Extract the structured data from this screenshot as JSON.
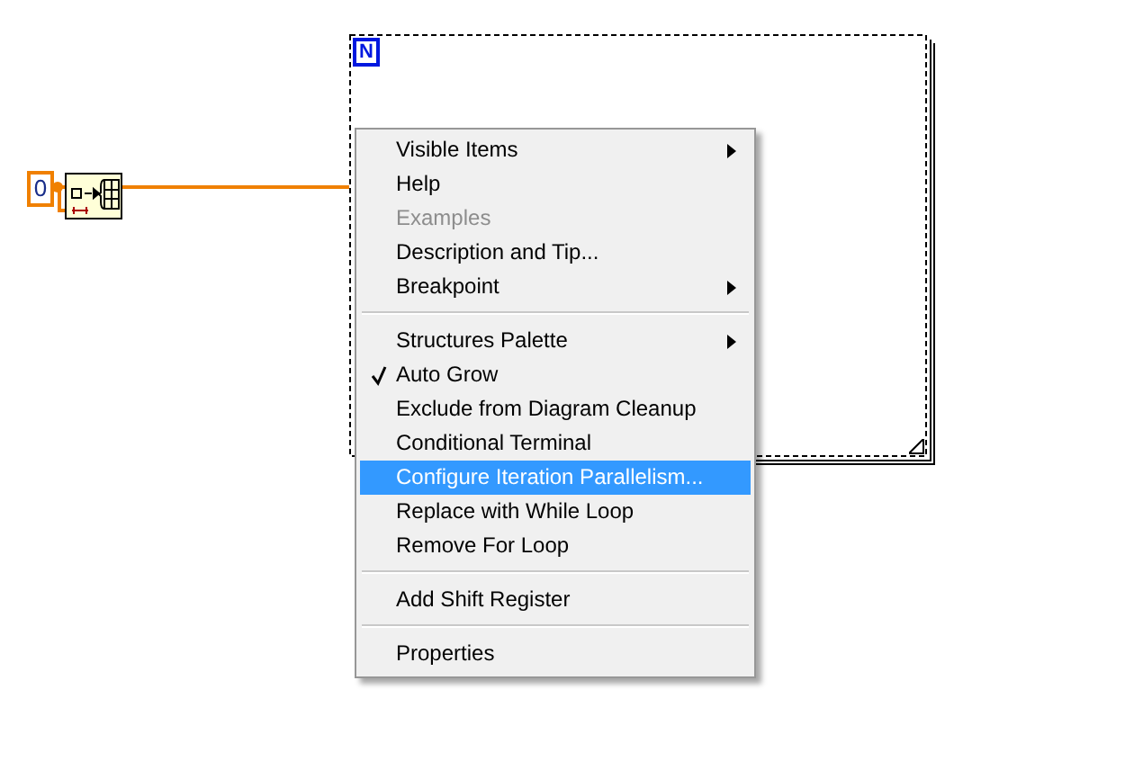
{
  "diagram": {
    "constant": "0",
    "loop_count_label": "N"
  },
  "context_menu": {
    "sections": [
      [
        {
          "label": "Visible Items",
          "submenu": true,
          "disabled": false,
          "checked": false,
          "selected": false
        },
        {
          "label": "Help",
          "submenu": false,
          "disabled": false,
          "checked": false,
          "selected": false
        },
        {
          "label": "Examples",
          "submenu": false,
          "disabled": true,
          "checked": false,
          "selected": false
        },
        {
          "label": "Description and Tip...",
          "submenu": false,
          "disabled": false,
          "checked": false,
          "selected": false
        },
        {
          "label": "Breakpoint",
          "submenu": true,
          "disabled": false,
          "checked": false,
          "selected": false
        }
      ],
      [
        {
          "label": "Structures Palette",
          "submenu": true,
          "disabled": false,
          "checked": false,
          "selected": false
        },
        {
          "label": "Auto Grow",
          "submenu": false,
          "disabled": false,
          "checked": true,
          "selected": false
        },
        {
          "label": "Exclude from Diagram Cleanup",
          "submenu": false,
          "disabled": false,
          "checked": false,
          "selected": false
        },
        {
          "label": "Conditional Terminal",
          "submenu": false,
          "disabled": false,
          "checked": false,
          "selected": false
        },
        {
          "label": "Configure Iteration Parallelism...",
          "submenu": false,
          "disabled": false,
          "checked": false,
          "selected": true
        },
        {
          "label": "Replace with While Loop",
          "submenu": false,
          "disabled": false,
          "checked": false,
          "selected": false
        },
        {
          "label": "Remove For Loop",
          "submenu": false,
          "disabled": false,
          "checked": false,
          "selected": false
        }
      ],
      [
        {
          "label": "Add Shift Register",
          "submenu": false,
          "disabled": false,
          "checked": false,
          "selected": false
        }
      ],
      [
        {
          "label": "Properties",
          "submenu": false,
          "disabled": false,
          "checked": false,
          "selected": false
        }
      ]
    ]
  }
}
